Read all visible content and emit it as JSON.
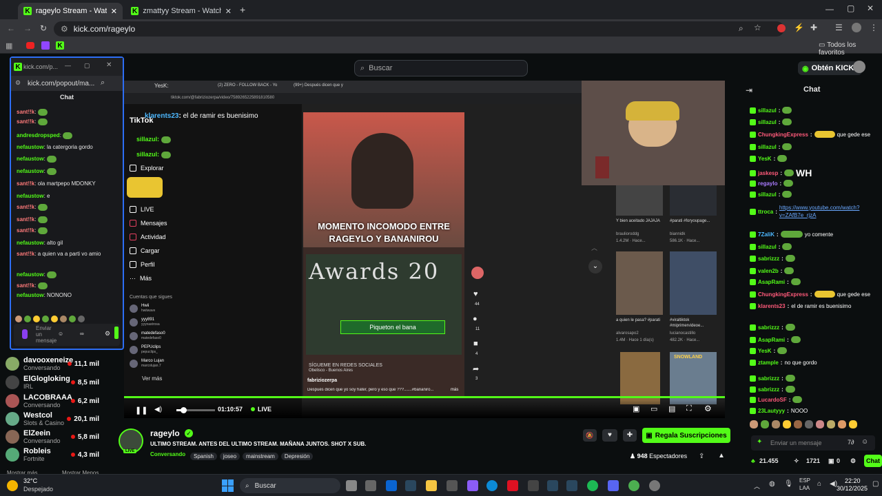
{
  "tabs": [
    {
      "label": "rageylo Stream - Watch Live o"
    },
    {
      "label": "zmattyy Stream - Watch Live o"
    }
  ],
  "address": {
    "url": "kick.com/rageylo"
  },
  "bookmarks": {
    "all_label": "Todos los favoritos"
  },
  "header": {
    "search_placeholder": "Buscar",
    "kicks_label": "Obtén KICKs"
  },
  "popout": {
    "url_short": "kick.com/p...",
    "url": "kick.com/popout/ma...",
    "title": "Chat",
    "messages": [
      {
        "user": "sant!!k",
        "text": ""
      },
      {
        "user": "sant!!k",
        "text": ""
      },
      {
        "user": "andresdropsped",
        "text": ""
      },
      {
        "user": "nefaustow",
        "text": "la catergoria gordo"
      },
      {
        "user": "nefaustow",
        "text": ""
      },
      {
        "user": "nefaustow",
        "text": ""
      },
      {
        "user": "sant!!k",
        "text": "ola martpepo MDONKY"
      },
      {
        "user": "nefaustow",
        "text": "e"
      },
      {
        "user": "sant!!k",
        "text": ""
      },
      {
        "user": "sant!!k",
        "text": ""
      },
      {
        "user": "sant!!k",
        "text": ""
      },
      {
        "user": "nefaustow",
        "text": "alto gil"
      },
      {
        "user": "sant!!k",
        "text": "a quien va a parti vo amio"
      },
      {
        "user": "nefaustow",
        "text": ""
      },
      {
        "user": "sant!!k",
        "text": ""
      },
      {
        "user": "nefaustow",
        "text": "NONONO"
      }
    ],
    "send_placeholder": "Enviar un mensaje"
  },
  "sidebar": {
    "channels": [
      {
        "name": "davooxeneize",
        "sub": "Conversando",
        "count": "11,1 mil"
      },
      {
        "name": "ElGlogloking",
        "sub": "IRL",
        "count": "8,5 mil"
      },
      {
        "name": "LACOBRAAA",
        "sub": "Conversando",
        "count": "6,2 mil"
      },
      {
        "name": "Westcol",
        "sub": "Slots & Casino",
        "count": "20,1 mil"
      },
      {
        "name": "ElZeein",
        "sub": "Conversando",
        "count": "5,8 mil"
      },
      {
        "name": "Robleis",
        "sub": "Fortnite",
        "count": "4,3 mil"
      }
    ],
    "show_more": "Mostrar más",
    "show_less": "Mostrar Menos"
  },
  "video": {
    "inner_tabs": [
      "YesK:",
      "(2) ZERO - FOLLOW BACK - Yo",
      "(99+) Después dicen que y"
    ],
    "inner_url": "tiktok.com/@fabriziozerpa/video/7589265225891810580",
    "overlay_chat": [
      {
        "user": "klarents23",
        "text": "el de ramir es buenisimo"
      },
      {
        "user": "sillazul",
        "text": ""
      },
      {
        "user": "sillazul",
        "text": ""
      }
    ],
    "tiktok_logo": "TikTok",
    "tiktok_menu": [
      "Explorar",
      "LIVE",
      "Mensajes",
      "Actividad",
      "Cargar",
      "Perfil",
      "Más"
    ],
    "following_title": "Cuentas que sigues",
    "following": [
      {
        "name": "Hwii",
        "handle": "hwiiwave"
      },
      {
        "name": "yyy891",
        "handle": "yyynastrosa"
      },
      {
        "name": "matedefaso0",
        "handle": "matedefaso0"
      },
      {
        "name": "PEPUclips",
        "handle": "pepuclips_"
      },
      {
        "name": "Marco Lujan",
        "handle": "marcolujan.7"
      }
    ],
    "see_more": "Ver más",
    "caption_top": "MOMENTO INCOMODO ENTRE",
    "caption_bottom": "RAGEYLO Y BANANIROU",
    "awards_text": "Awards 20",
    "piqueton": "Piqueton el bana",
    "author": "fabriziozerpa",
    "description": "Después dicen que yo soy hater, pero y eso que ???.......#bananiro...",
    "more": "más",
    "location": "Obelisco - Buenos Aires",
    "redes": "SÍGUEME EN REDES SOCIALES",
    "side_counts": [
      "44",
      "11",
      "4",
      "3"
    ],
    "thumbs": [
      {
        "title": "Y bien aceitado JAJAJA",
        "author": "braulioroddg",
        "stats": "1.4.2M · Hace..."
      },
      {
        "title": "#parati #foryoupage...",
        "author": "biannidk",
        "stats": "586.1K · Hace..."
      },
      {
        "title": "a quien le pasa? #parati",
        "author": "alvarosapo2",
        "stats": "1.4M · Hace 1 día(s)"
      },
      {
        "title": "#viraltiktok #miprimervideoe...",
        "author": "lucianocastillo",
        "stats": "482.2K · Hace..."
      }
    ],
    "snowland": "SNOWLAND",
    "time": "01:10:57",
    "live_label": "LIVE",
    "progress": 0.0
  },
  "stream": {
    "streamer": "rageylo",
    "title": "ULTIMO STREAM. ANTES DEL ULTIMO STREAM. MAÑANA JUNTOS. SHOT X SUB.",
    "category": "Conversando",
    "tags": [
      "Spanish",
      "joseo",
      "mainstream",
      "Depresión"
    ],
    "viewers": "948",
    "viewers_label": "Espectadores",
    "gift_button": "Regala Suscripciones",
    "live_badge": "LIVE"
  },
  "chat": {
    "title": "Chat",
    "messages": [
      {
        "user": "sillazul",
        "text": "",
        "color": "#53fc18"
      },
      {
        "user": "sillazul",
        "text": "",
        "color": "#53fc18"
      },
      {
        "user": "ChungkingExpress",
        "text": "que gede ese",
        "color": "#ff5a7a"
      },
      {
        "user": "sillazul",
        "text": "",
        "color": "#53fc18"
      },
      {
        "user": "YesK",
        "text": "",
        "color": "#53fc18"
      },
      {
        "user": "jaskesp",
        "text": "WH",
        "color": "#ff5a7a"
      },
      {
        "user": "regaylo",
        "text": "",
        "color": "#a97bff"
      },
      {
        "user": "sillazul",
        "text": "",
        "color": "#53fc18"
      },
      {
        "user": "ttroca",
        "text": "https://www.youtube.com/watch?v=ZAfB7e_rjzA",
        "color": "#53fc18"
      },
      {
        "user": "7ZaliK",
        "text": "yo comente",
        "color": "#4db8ff"
      },
      {
        "user": "sillazul",
        "text": "",
        "color": "#53fc18"
      },
      {
        "user": "sabrizzz",
        "text": "",
        "color": "#53fc18"
      },
      {
        "user": "valen2b",
        "text": "",
        "color": "#53fc18"
      },
      {
        "user": "AsapRami",
        "text": "",
        "color": "#53fc18"
      },
      {
        "user": "ChungkingExpress",
        "text": "que gede ese",
        "color": "#ff5a7a"
      },
      {
        "user": "klarents23",
        "text": "el de ramir es buenisimo",
        "color": "#ff5a7a"
      },
      {
        "user": "sabrizzz",
        "text": "",
        "color": "#53fc18"
      },
      {
        "user": "AsapRami",
        "text": "",
        "color": "#53fc18"
      },
      {
        "user": "YesK",
        "text": "",
        "color": "#53fc18"
      },
      {
        "user": "ztample",
        "text": "no que gordo",
        "color": "#53fc18"
      },
      {
        "user": "sabrizzz",
        "text": "",
        "color": "#53fc18"
      },
      {
        "user": "sabrizzz",
        "text": "",
        "color": "#53fc18"
      },
      {
        "user": "LucardoSF",
        "text": "",
        "color": "#ff5a7a"
      },
      {
        "user": "23Lautyyy",
        "text": "NOOO",
        "color": "#53fc18"
      }
    ],
    "input_placeholder": "Enviar un mensaje",
    "points": "21.455",
    "sub_count": "1721",
    "zero": "0",
    "chat_button": "Chat"
  },
  "taskbar": {
    "weather_temp": "32°C",
    "weather_desc": "Despejado",
    "search": "Buscar",
    "lang": "ESP",
    "lang2": "LAA",
    "time": "22:20",
    "date": "30/12/2025"
  },
  "colors": {
    "kick_green": "#53fc18",
    "bg": "#0b0e0f",
    "popout_border": "#2d6ef5"
  }
}
